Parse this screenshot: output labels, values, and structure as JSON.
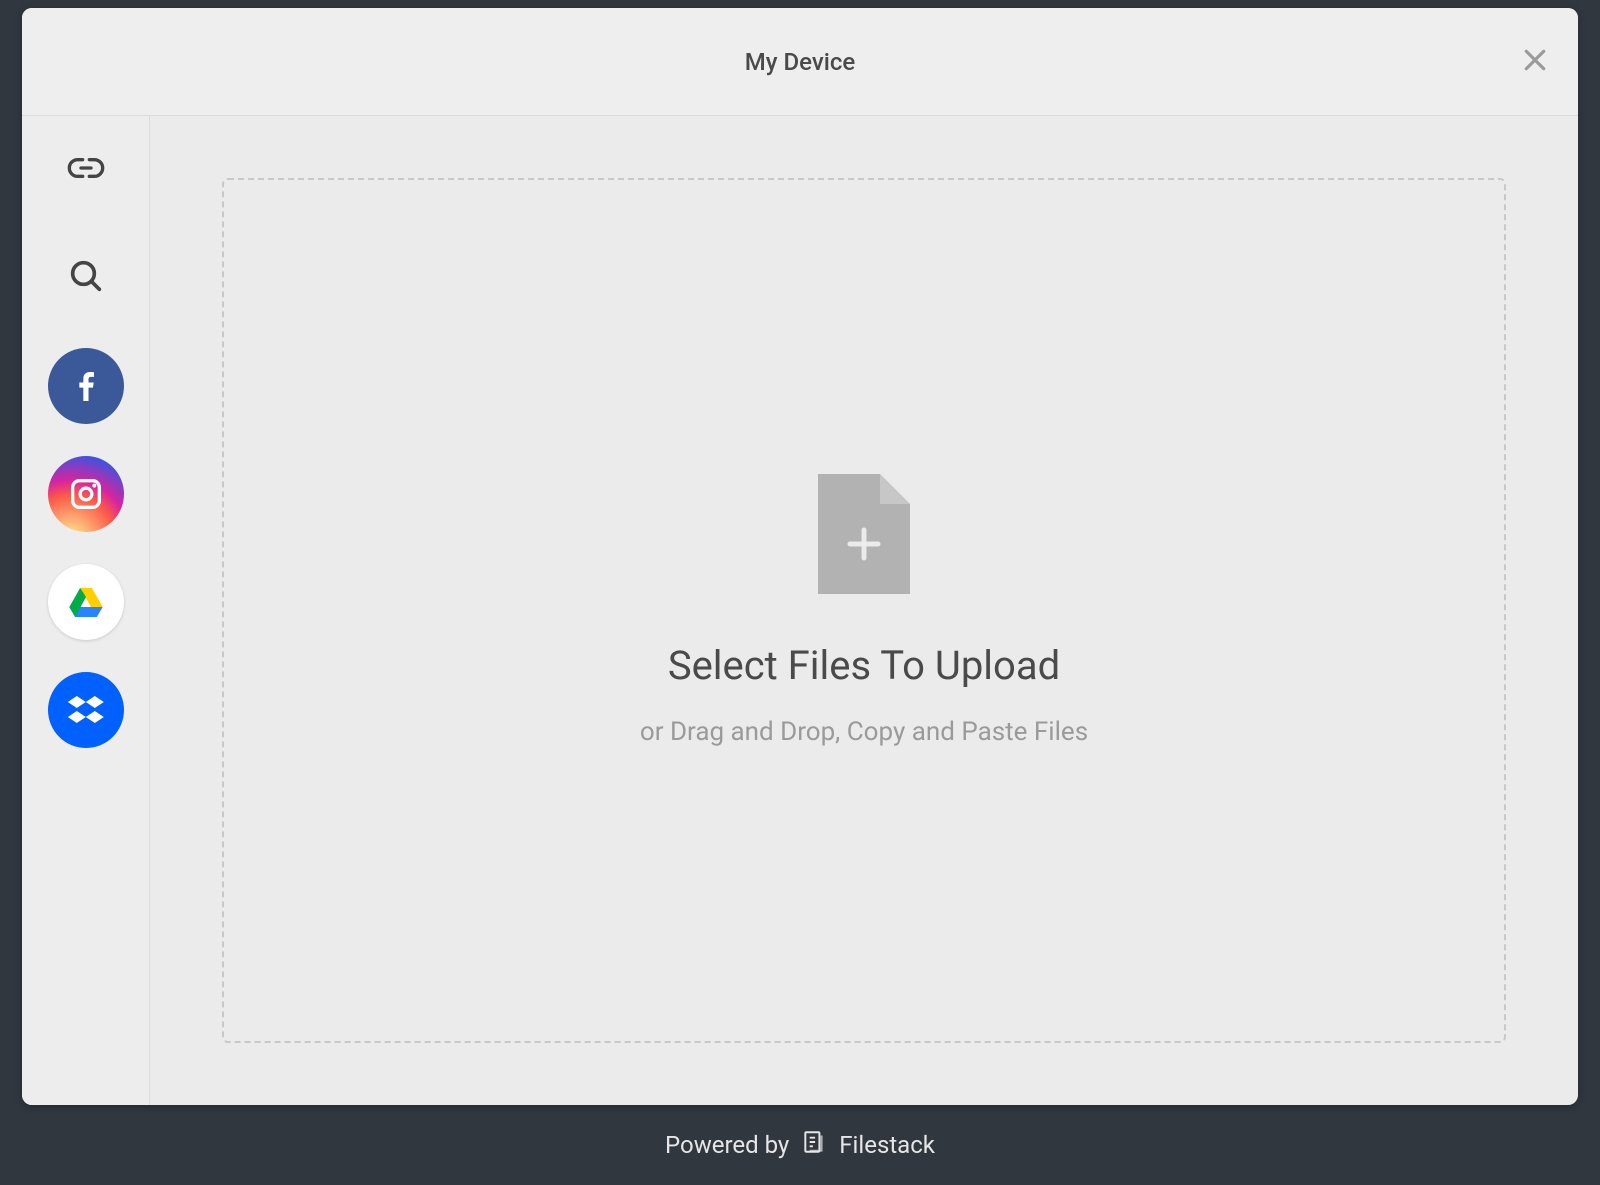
{
  "header": {
    "title": "My Device"
  },
  "sidebar": {
    "sources": [
      {
        "id": "my-device",
        "icon": "laptop-icon",
        "selected": true
      },
      {
        "id": "link",
        "icon": "link-icon",
        "selected": false
      },
      {
        "id": "search",
        "icon": "search-icon",
        "selected": false
      },
      {
        "id": "facebook",
        "icon": "facebook-icon",
        "selected": false
      },
      {
        "id": "instagram",
        "icon": "instagram-icon",
        "selected": false
      },
      {
        "id": "google-drive",
        "icon": "google-drive-icon",
        "selected": false
      },
      {
        "id": "dropbox",
        "icon": "dropbox-icon",
        "selected": false
      }
    ]
  },
  "dropzone": {
    "title": "Select Files To Upload",
    "subtitle": "or Drag and Drop, Copy and Paste Files"
  },
  "footer": {
    "prefix": "Powered by",
    "brand": "Filestack"
  },
  "background": {
    "powered_by_hint": "Powered by",
    "powered_by_brand": "Filestack"
  },
  "colors": {
    "modal_bg": "#ebebeb",
    "backdrop": "#30373f",
    "border": "#dcdcdc",
    "text_primary": "#4a4a4a",
    "text_muted": "#9a9a9a",
    "facebook": "#3b5998",
    "dropbox": "#0061ff"
  }
}
